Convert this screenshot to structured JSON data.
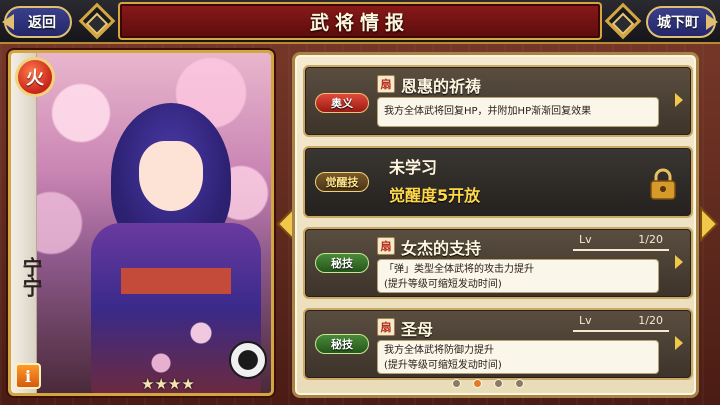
{
  "header": {
    "title": "武将情报",
    "back_label": "返回",
    "town_label": "城下町"
  },
  "card": {
    "element": "火",
    "name": "宁宁",
    "info_label": "i",
    "rarity_stars": "★★★★",
    "rarity_count": 4
  },
  "skills": [
    {
      "badge": "奥义",
      "badge_style": "red",
      "name": "恩惠的祈祷",
      "description": "我方全体武将回复HP，并附加HP渐渐回复效果",
      "locked": false
    },
    {
      "badge": "觉醒技",
      "badge_style": "gold",
      "title": "未学习",
      "subtitle": "觉醒度5开放",
      "locked": true
    },
    {
      "badge": "秘技",
      "badge_style": "green",
      "name": "女杰的支持",
      "level_label": "Lv",
      "level_value": "1/20",
      "description": "「弹」类型全体武将的攻击力提升\n(提升等级可缩短发动时间)",
      "locked": false
    },
    {
      "badge": "秘技",
      "badge_style": "green",
      "name": "圣母",
      "level_label": "Lv",
      "level_value": "1/20",
      "description": "我方全体武将防御力提升\n(提升等级可缩短发动时间)",
      "locked": false
    }
  ],
  "pagination": {
    "total": 4,
    "active_index": 1
  },
  "colors": {
    "accent_gold": "#d4a640",
    "title_red": "#8a1a1a",
    "nav_blue": "#3a3f8a",
    "unlock_yellow": "#ffd84a"
  }
}
